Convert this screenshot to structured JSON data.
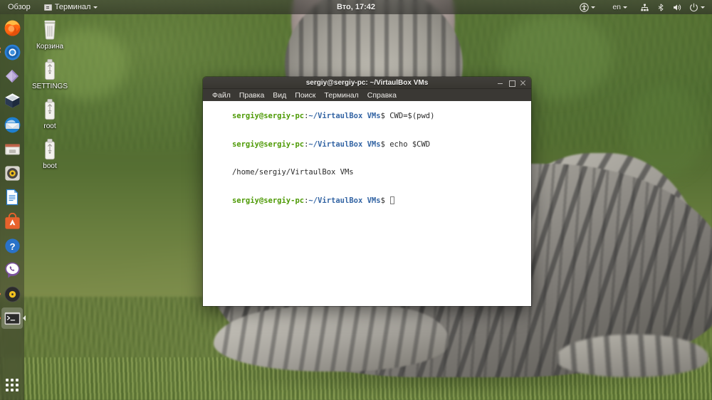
{
  "top_panel": {
    "overview_label": "Обзор",
    "app_menu": {
      "label": "Терминал",
      "icon": "terminal-icon"
    },
    "clock": "Вто, 17:42",
    "indicators": {
      "accessibility": "accessibility-icon",
      "keyboard_layout": "en",
      "network": "network-icon",
      "bluetooth": "bluetooth-icon",
      "volume": "volume-icon",
      "power": "power-icon"
    }
  },
  "launcher": {
    "items": [
      {
        "name": "firefox",
        "label": "Firefox"
      },
      {
        "name": "chromium",
        "label": "Chromium"
      },
      {
        "name": "files-purple",
        "label": "Files"
      },
      {
        "name": "virtualbox",
        "label": "VirtualBox"
      },
      {
        "name": "thunderbird",
        "label": "Thunderbird"
      },
      {
        "name": "nautilus",
        "label": "Файлы"
      },
      {
        "name": "settings",
        "label": "Параметры"
      },
      {
        "name": "libreoffice-writer",
        "label": "LibreOffice Writer"
      },
      {
        "name": "ubuntu-software",
        "label": "Менеджер приложений"
      },
      {
        "name": "help",
        "label": "Справка"
      },
      {
        "name": "viber",
        "label": "Viber"
      },
      {
        "name": "rhythmbox",
        "label": "Rhythmbox"
      },
      {
        "name": "terminal",
        "label": "Терминал"
      }
    ],
    "show_applications": "Показать приложения"
  },
  "desktop_icons": [
    {
      "label": "Корзина",
      "icon": "trash-icon"
    },
    {
      "label": "SETTINGS",
      "icon": "usb-drive-icon"
    },
    {
      "label": "root",
      "icon": "usb-drive-icon"
    },
    {
      "label": "boot",
      "icon": "usb-drive-icon"
    }
  ],
  "terminal": {
    "title": "sergiy@sergiy-pc: ~/VirtaulBox VMs",
    "menus": [
      "Файл",
      "Правка",
      "Вид",
      "Поиск",
      "Терминал",
      "Справка"
    ],
    "window_buttons": {
      "minimize": "−",
      "maximize": "□",
      "close": "×"
    },
    "prompt": {
      "user_host": "sergiy@sergiy-pc",
      "separator": ":",
      "path": "~/VirtaulBox VMs",
      "symbol": "$"
    },
    "lines": [
      {
        "type": "prompt",
        "command": "CWD=$(pwd)"
      },
      {
        "type": "prompt",
        "command": "echo $CWD"
      },
      {
        "type": "output",
        "text": "/home/sergiy/VirtaulBox VMs"
      },
      {
        "type": "prompt",
        "command": ""
      }
    ]
  },
  "colors": {
    "accent_orange": "#f07746",
    "prompt_green": "#4e9a06",
    "prompt_blue": "#3465a4",
    "terminal_bg": "#ffffff",
    "panel_bg": "#3c3b37"
  }
}
